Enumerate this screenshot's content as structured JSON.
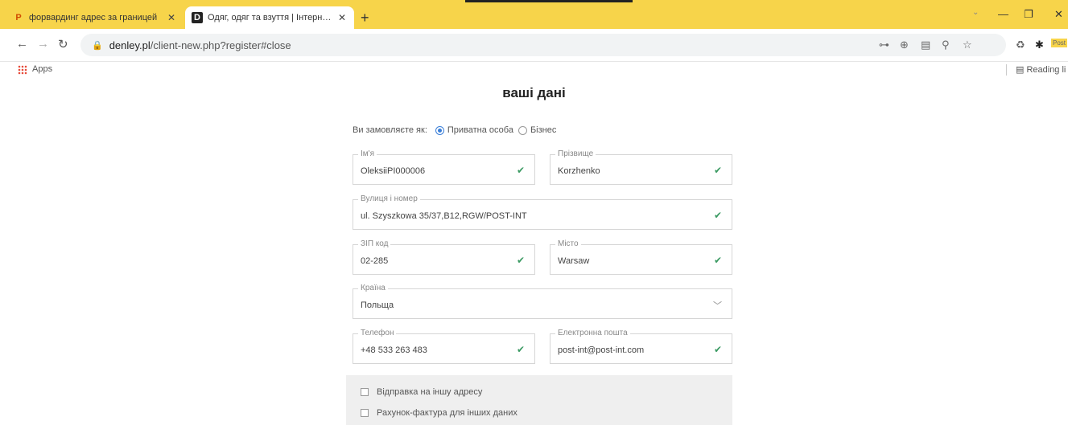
{
  "browser": {
    "tabs": [
      {
        "title": "форвардинг адрес за границей",
        "favicon": "P",
        "active": false
      },
      {
        "title": "Одяг, одяг та взуття | Інтернет-м",
        "favicon": "D",
        "active": true
      }
    ],
    "new_tab_symbol": "+",
    "url_host": "denley.pl",
    "url_path": "/client-new.php?register#close",
    "bookmarks": {
      "apps_label": "Apps",
      "reading_list_label": "Reading li"
    }
  },
  "page": {
    "title": "ваші дані",
    "order_as_label": "Ви замовляєте як:",
    "order_options": [
      {
        "label": "Приватна особа",
        "selected": true
      },
      {
        "label": "Бізнес",
        "selected": false
      }
    ],
    "fields": {
      "first_name": {
        "label": "Ім'я",
        "value": "OleksiiPI000006"
      },
      "last_name": {
        "label": "Прізвище",
        "value": "Korzhenko"
      },
      "street": {
        "label": "Вулиця і номер",
        "value": "ul. Szyszkowa 35/37,B12,RGW/POST-INT"
      },
      "zip": {
        "label": "ЗІП код",
        "value": "02-285"
      },
      "city": {
        "label": "Місто",
        "value": "Warsaw"
      },
      "country": {
        "label": "Країна",
        "value": "Польща"
      },
      "phone": {
        "label": "Телефон",
        "value": "+48 533 263 483"
      },
      "email": {
        "label": "Електронна пошта",
        "value": "post-int@post-int.com"
      }
    },
    "options": [
      {
        "label": "Відправка на іншу адресу",
        "checked": false
      },
      {
        "label": "Рахунок-фактура для інших даних",
        "checked": false
      }
    ]
  },
  "colors": {
    "tabstrip": "#f7d44a",
    "check": "#3a9a62",
    "radio_selected": "#3b7fd8"
  }
}
